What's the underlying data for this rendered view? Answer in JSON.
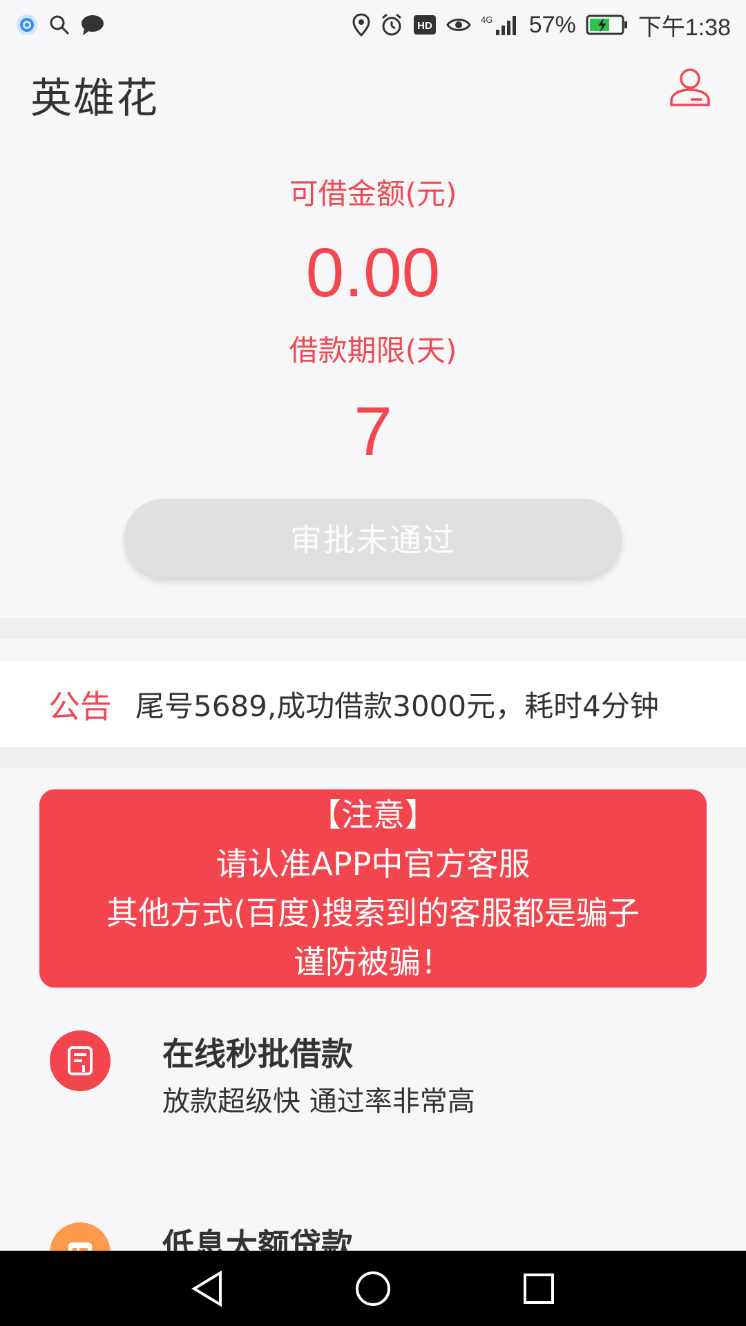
{
  "status_bar": {
    "battery": "57%",
    "time": "下午1:38",
    "network": "4G",
    "hd": "HD"
  },
  "header": {
    "title": "英雄花"
  },
  "loan": {
    "amount_label": "可借金额(元)",
    "amount_value": "0.00",
    "term_label": "借款期限(天)",
    "term_value": "7",
    "status_button": "审批未通过"
  },
  "notice": {
    "label": "公告",
    "text": "尾号5689,成功借款3000元，耗时4分钟"
  },
  "alert": {
    "line1": "【注意】",
    "line2": "请认准APP中官方客服",
    "line3": "其他方式(百度)搜索到的客服都是骗子",
    "line4": "谨防被骗！"
  },
  "features": [
    {
      "title": "在线秒批借款",
      "subtitle": "放款超级快  通过率非常高",
      "icon": "document-icon",
      "color": "#f3454d"
    },
    {
      "title": "低息大额贷款",
      "icon": "card-icon",
      "color": "#ff9a4d"
    }
  ]
}
